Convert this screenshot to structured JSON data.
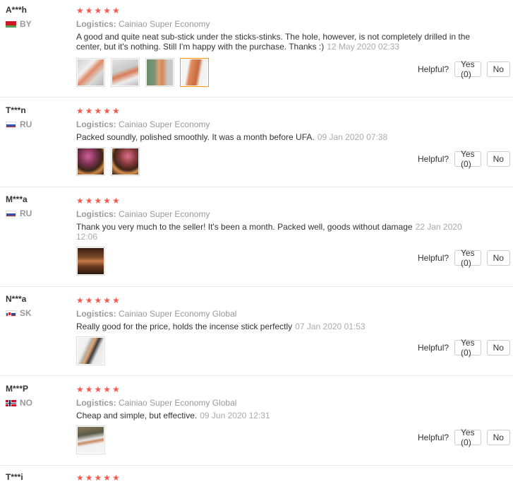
{
  "helpful_label": "Helpful?",
  "reviews": [
    {
      "user": "A***h",
      "country": "BY",
      "flag": "by-flag-icon",
      "stars": "★★★★★",
      "logistics_label": "Logistics:",
      "logistics": "Cainiao Super Economy",
      "text": "A good and quite neat sub-stick under the sticks-stinks. The hole, however, is not completely drilled in the center, but it's nothing. Still I'm happy with the purchase. Thanks :)",
      "date": "12 May 2020 02:33",
      "yes": "Yes (0)",
      "no": "No"
    },
    {
      "user": "T***n",
      "country": "RU",
      "flag": "ru-flag-icon",
      "stars": "★★★★★",
      "logistics_label": "Logistics:",
      "logistics": "Cainiao Super Economy",
      "text": "Packed soundly, polished smoothly. It was a month before UFA.",
      "date": "09 Jan 2020 07:38",
      "yes": "Yes (0)",
      "no": "No"
    },
    {
      "user": "M***a",
      "country": "RU",
      "flag": "ru-flag-icon",
      "stars": "★★★★★",
      "logistics_label": "Logistics:",
      "logistics": "Cainiao Super Economy",
      "text": "Thank you very much to the seller! It's been a month. Packed well, goods without damage",
      "date": "22 Jan 2020 12:06",
      "yes": "Yes (0)",
      "no": "No"
    },
    {
      "user": "N***a",
      "country": "SK",
      "flag": "sk-flag-icon",
      "stars": "★★★★★",
      "logistics_label": "Logistics:",
      "logistics": "Cainiao Super Economy Global",
      "text": "Really good for the price, holds the incense stick perfectly",
      "date": "07 Jan 2020 01:53",
      "yes": "Yes (0)",
      "no": "No"
    },
    {
      "user": "M***P",
      "country": "NO",
      "flag": "no-flag-icon",
      "stars": "★★★★★",
      "logistics_label": "Logistics:",
      "logistics": "Cainiao Super Economy Global",
      "text": "Cheap and simple, but effective.",
      "date": "09 Jun 2020 12:31",
      "yes": "Yes (0)",
      "no": "No"
    },
    {
      "user": "T***i",
      "country": "",
      "flag": "",
      "stars": "★★★★★"
    }
  ]
}
